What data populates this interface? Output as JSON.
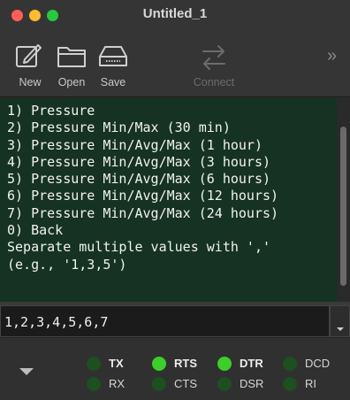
{
  "window": {
    "title": "Untitled_1"
  },
  "toolbar": {
    "new_label": "New",
    "open_label": "Open",
    "save_label": "Save",
    "connect_label": "Connect",
    "more_label": "»"
  },
  "terminal": {
    "lines": [
      "1) Pressure",
      "2) Pressure Min/Max (30 min)",
      "3) Pressure Min/Avg/Max (1 hour)",
      "4) Pressure Min/Avg/Max (3 hours)",
      "5) Pressure Min/Avg/Max (6 hours)",
      "6) Pressure Min/Avg/Max (12 hours)",
      "7) Pressure Min/Avg/Max (24 hours)",
      "0) Back",
      "Separate multiple values with ','",
      "(e.g., '1,3,5')"
    ]
  },
  "send": {
    "value": "1,2,3,4,5,6,7"
  },
  "signals": {
    "tx": {
      "label": "TX",
      "active": false
    },
    "rts": {
      "label": "RTS",
      "active": true
    },
    "dtr": {
      "label": "DTR",
      "active": true
    },
    "dcd": {
      "label": "DCD",
      "active": false
    },
    "rx": {
      "label": "RX",
      "active": false
    },
    "cts": {
      "label": "CTS",
      "active": false
    },
    "dsr": {
      "label": "DSR",
      "active": false
    },
    "ri": {
      "label": "RI",
      "active": false
    }
  },
  "colors": {
    "terminal_bg": "#163222",
    "led_on": "#3ccf2a",
    "led_off": "#1d4f20"
  }
}
